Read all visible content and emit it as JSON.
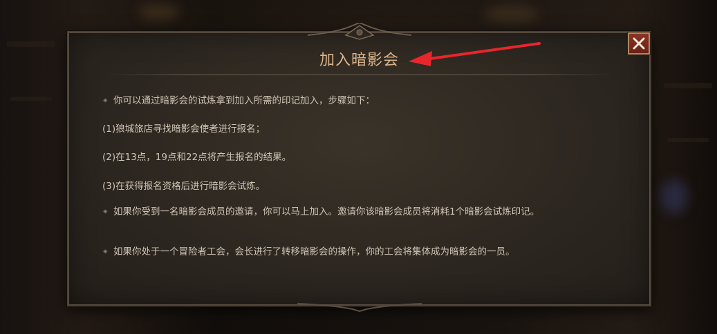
{
  "dialog": {
    "title": "加入暗影会",
    "close_icon": "close-icon",
    "bullet_glyph": "✷",
    "paragraphs": [
      {
        "bullet": true,
        "text": "你可以通过暗影会的试炼拿到加入所需的印记加入，步骤如下："
      },
      {
        "bullet": false,
        "text": "(1)狼城旅店寻找暗影会使者进行报名；"
      },
      {
        "bullet": false,
        "text": "(2)在13点，19点和22点将产生报名的结果。"
      },
      {
        "bullet": false,
        "text": "(3)在获得报名资格后进行暗影会试炼。"
      },
      {
        "bullet": true,
        "text": "如果你受到一名暗影会成员的邀请，你可以马上加入。邀请你该暗影会成员将消耗1个暗影会试炼印记。"
      },
      {
        "bullet": true,
        "text": "如果你处于一个冒险者工会，会长进行了转移暗影会的操作，你的工会将集体成为暗影会的一员。"
      }
    ]
  },
  "annotation": {
    "arrow_color": "#e8262b"
  },
  "colors": {
    "title": "#d9b48a",
    "body_text": "#cfc4b4",
    "close_button": "#7a2b1c"
  }
}
